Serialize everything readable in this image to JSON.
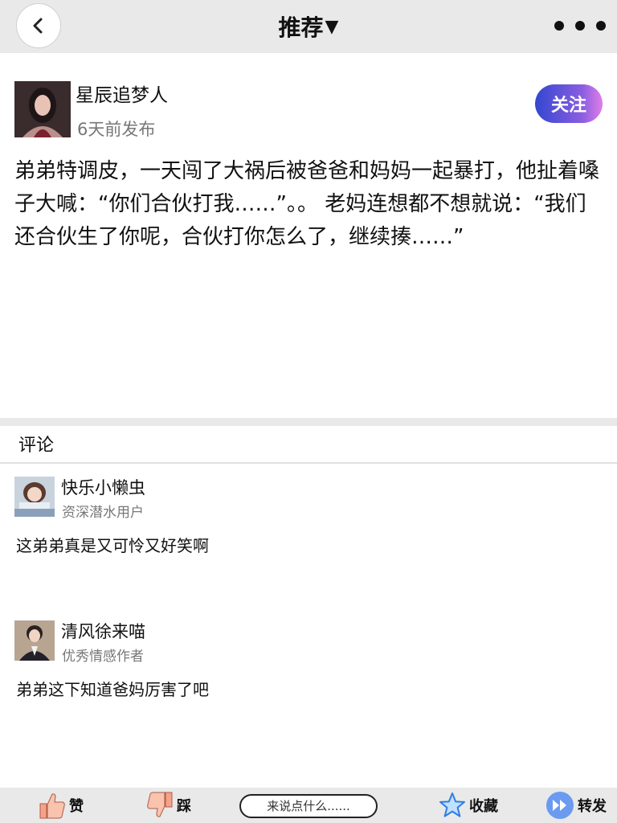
{
  "header": {
    "title": "推荐",
    "caret": "▼",
    "back_icon": "chevron-left-icon",
    "more_icon": "more-dots-icon"
  },
  "post": {
    "author_name": "星辰追梦人",
    "posted_time": "6天前发布",
    "follow_label": "关注",
    "content": "弟弟特调皮，一天闯了大祸后被爸爸和妈妈一起暴打，他扯着嗓子大喊：“你们合伙打我……”。。 老妈连想都不想就说：“我们还合伙生了你呢，合伙打你怎么了，继续揍……”"
  },
  "comments_section": {
    "label": "评论",
    "items": [
      {
        "name": "快乐小懒虫",
        "role": "资深潜水用户",
        "text": "这弟弟真是又可怜又好笑啊"
      },
      {
        "name": "清风徐来喵",
        "role": "优秀情感作者",
        "text": "弟弟这下知道爸妈厉害了吧"
      }
    ]
  },
  "bottom_bar": {
    "like_label": "赞",
    "dislike_label": "踩",
    "comment_placeholder": "来说点什么......",
    "favorite_label": "收藏",
    "share_label": "转发"
  },
  "colors": {
    "bar_background": "#e9e9e9",
    "follow_gradient_start": "#3447d0",
    "follow_gradient_end": "#e07ee8",
    "secondary_text": "#777777",
    "like_icon": "#f4a38a",
    "favorite_icon": "#2f7de0",
    "share_icon": "#3a6fe0"
  }
}
